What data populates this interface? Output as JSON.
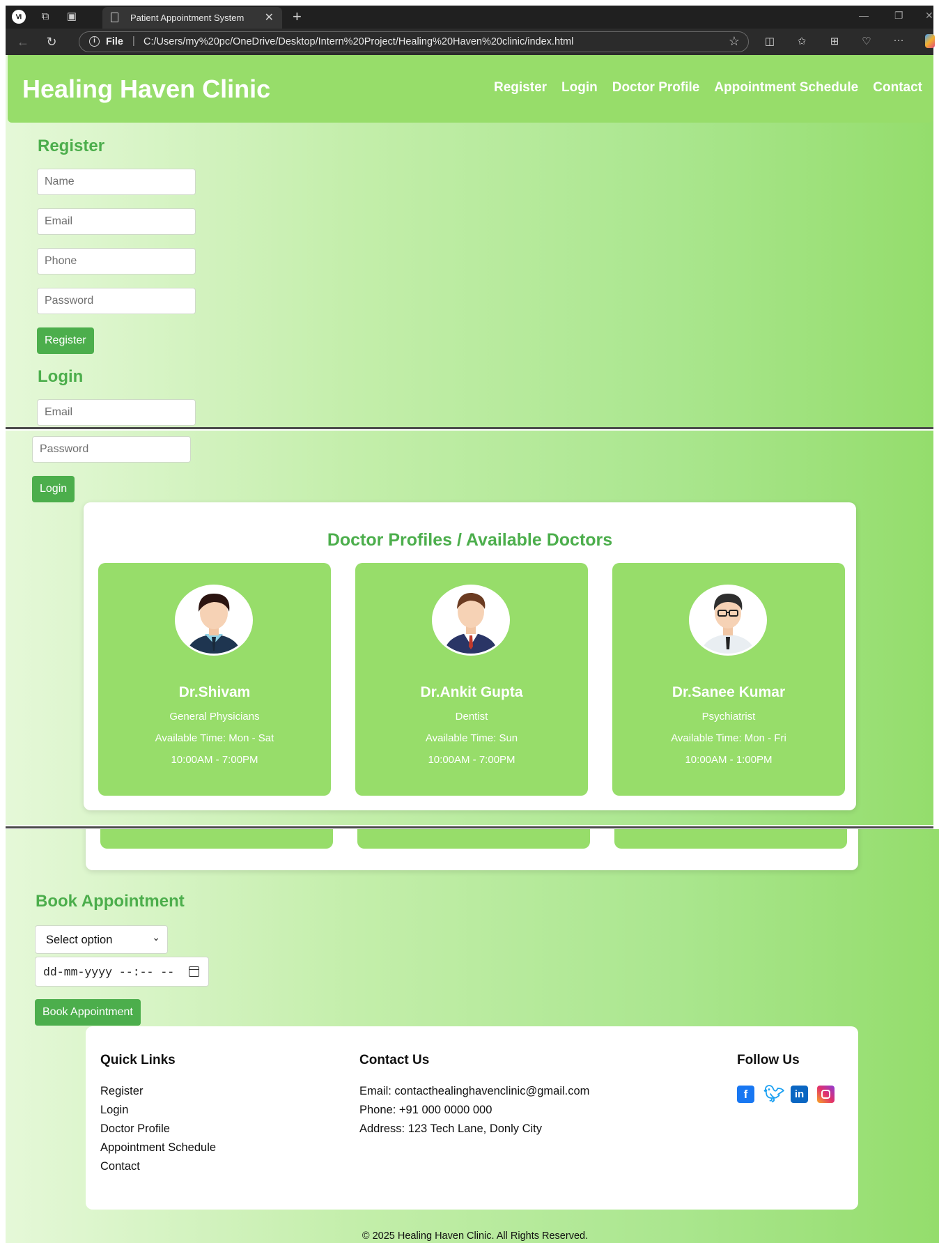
{
  "browser": {
    "tab_title": "Patient Appointment System",
    "address_scheme": "File",
    "address_url": "C:/Users/my%20pc/OneDrive/Desktop/Intern%20Project/Healing%20Haven%20clinic/index.html"
  },
  "header": {
    "brand": "Healing Haven Clinic",
    "nav": [
      "Register",
      "Login",
      "Doctor Profile",
      "Appointment Schedule",
      "Contact"
    ]
  },
  "register": {
    "title": "Register",
    "name_placeholder": "Name",
    "email_placeholder": "Email",
    "phone_placeholder": "Phone",
    "password_placeholder": "Password",
    "button": "Register"
  },
  "login": {
    "title": "Login",
    "email_placeholder": "Email",
    "password_placeholder": "Password",
    "button": "Login"
  },
  "doctors": {
    "title": "Doctor Profiles / Available Doctors",
    "items": [
      {
        "name": "Dr.Shivam",
        "specialty": "General Physicians",
        "days": "Available Time: Mon - Sat",
        "hours": "10:00AM - 7:00PM"
      },
      {
        "name": "Dr.Ankit Gupta",
        "specialty": "Dentist",
        "days": "Available Time: Sun",
        "hours": "10:00AM - 7:00PM"
      },
      {
        "name": "Dr.Sanee Kumar",
        "specialty": "Psychiatrist",
        "days": "Available Time: Mon - Fri",
        "hours": "10:00AM - 1:00PM"
      }
    ]
  },
  "appointment": {
    "title": "Book Appointment",
    "select_value": "Select option",
    "datetime_placeholder": "dd-mm-yyyy --:-- --",
    "button": "Book Appointment"
  },
  "footer": {
    "quick_links_title": "Quick Links",
    "quick_links": [
      "Register",
      "Login",
      "Doctor Profile",
      "Appointment Schedule",
      "Contact"
    ],
    "contact_title": "Contact Us",
    "contact_lines": [
      "Email: contacthealinghavenclinic@gmail.com",
      "Phone: +91 000 0000 000",
      "Address: 123 Tech Lane, Donly City"
    ],
    "follow_title": "Follow Us",
    "social_icons": [
      "facebook-icon",
      "twitter-icon",
      "linkedin-icon",
      "instagram-icon"
    ],
    "copyright": "© 2025 Healing Haven Clinic. All Rights Reserved."
  },
  "colors": {
    "header_green": "#97dd6a",
    "accent_green": "#4cae4c",
    "card_green": "#97dd6a",
    "facebook": "#1877f2",
    "twitter": "#1da1f2",
    "linkedin": "#0a66c2",
    "instagram": "#e1306c"
  }
}
